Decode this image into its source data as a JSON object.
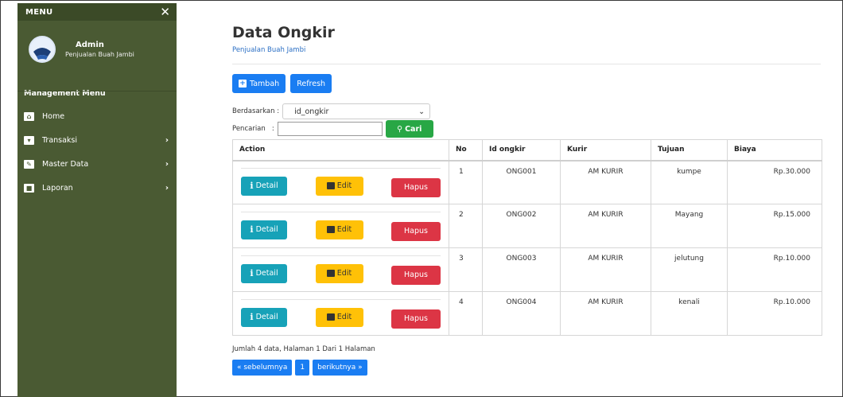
{
  "sidebar": {
    "menu_title": "MENU",
    "close_symbol": "✕",
    "user_name": "Admin",
    "user_subtitle": "Penjualan Buah Jambi",
    "section_label": "Management Menu",
    "items": [
      {
        "label": "Home",
        "icon": "home-icon",
        "chevron": ""
      },
      {
        "label": "Transaksi",
        "icon": "cart-icon",
        "chevron": "›"
      },
      {
        "label": "Master Data",
        "icon": "edit-icon",
        "chevron": "›"
      },
      {
        "label": "Laporan",
        "icon": "folder-icon",
        "chevron": "›"
      }
    ]
  },
  "page": {
    "title": "Data Ongkir",
    "subtitle": "Penjualan Buah Jambi"
  },
  "toolbar": {
    "add_label": "Tambah",
    "refresh_label": "Refresh"
  },
  "filter": {
    "by_label": "Berdasarkan :",
    "by_value": "id_ongkir",
    "search_label": "Pencarian   :",
    "search_value": "",
    "search_button": "Cari"
  },
  "table": {
    "headers": [
      "Action",
      "No",
      "Id ongkir",
      "Kurir",
      "Tujuan",
      "Biaya"
    ],
    "action_labels": {
      "detail": "Detail",
      "edit": "Edit",
      "hapus": "Hapus"
    },
    "rows": [
      {
        "no": "1",
        "id": "ONG001",
        "kurir": "AM KURIR",
        "tujuan": "kumpe",
        "biaya": "Rp.30.000"
      },
      {
        "no": "2",
        "id": "ONG002",
        "kurir": "AM KURIR",
        "tujuan": "Mayang",
        "biaya": "Rp.15.000"
      },
      {
        "no": "3",
        "id": "ONG003",
        "kurir": "AM KURIR",
        "tujuan": "jelutung",
        "biaya": "Rp.10.000"
      },
      {
        "no": "4",
        "id": "ONG004",
        "kurir": "AM KURIR",
        "tujuan": "kenali",
        "biaya": "Rp.10.000"
      }
    ]
  },
  "footer": {
    "summary": "Jumlah 4 data, Halaman 1 Dari 1 Halaman",
    "prev": "« sebelumnya",
    "page": "1",
    "next": "berikutnya »"
  },
  "colors": {
    "sidebar": "#4a5a33",
    "primary": "#1a7df2",
    "success": "#28a745",
    "info": "#17a2b8",
    "warning": "#ffc107",
    "danger": "#dc3545"
  }
}
